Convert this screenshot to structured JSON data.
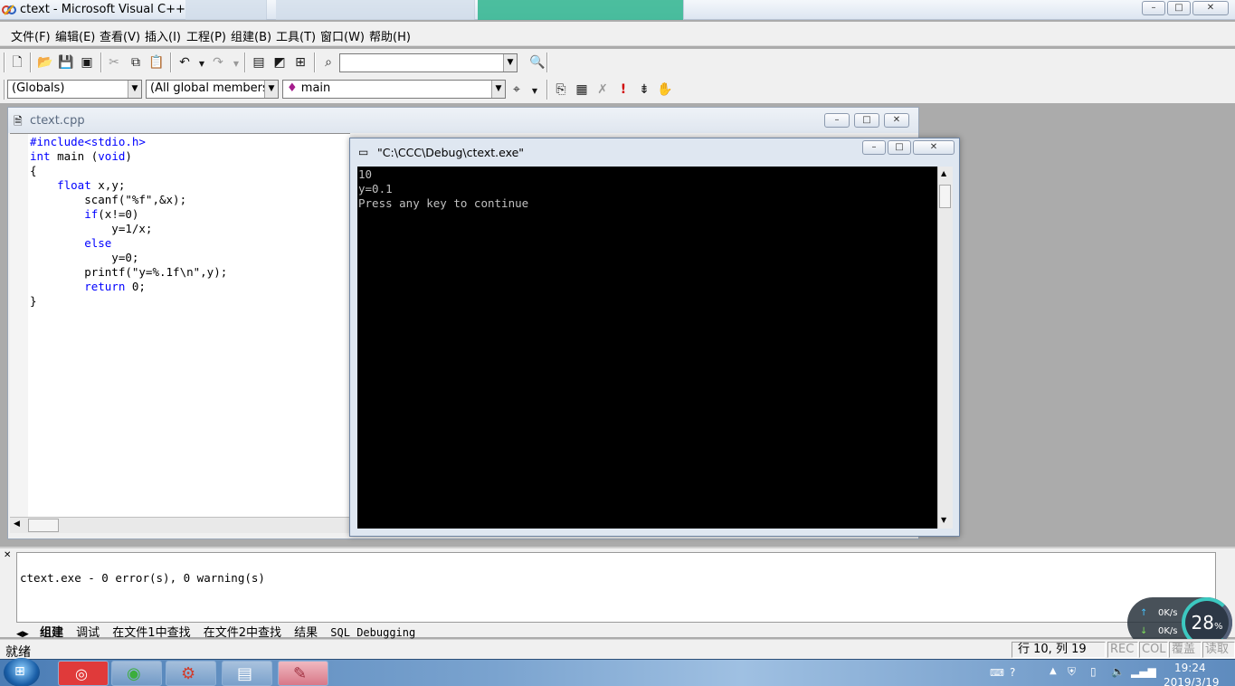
{
  "window": {
    "title": "ctext - Microsoft Visual C++",
    "buttons": {
      "minimize": "–",
      "maximize": "□",
      "close": "✕"
    }
  },
  "menu": {
    "items": [
      "文件(F)",
      "编辑(E)",
      "查看(V)",
      "插入(I)",
      "工程(P)",
      "组建(B)",
      "工具(T)",
      "窗口(W)",
      "帮助(H)"
    ]
  },
  "wizardbar": {
    "class_combo": "(Globals)",
    "filter_combo": "(All global members",
    "member_combo": "main"
  },
  "editor": {
    "filename": "ctext.cpp",
    "code_lines": [
      "#include<stdio.h>",
      "int main (void)",
      "{",
      "    float x,y;",
      "        scanf(\"%f\",&x);",
      "        if(x!=0)",
      "            y=1/x;",
      "        else",
      "            y=0;",
      "        printf(\"y=%.1f\\n\",y);",
      "        return 0;",
      "}"
    ]
  },
  "console": {
    "title": "\"C:\\CCC\\Debug\\ctext.exe\"",
    "lines": [
      "10",
      "y=0.1",
      "Press any key to continue"
    ]
  },
  "output": {
    "message": "ctext.exe - 0 error(s), 0 warning(s)",
    "tabs": [
      "组建",
      "调试",
      "在文件1中查找",
      "在文件2中查找",
      "结果",
      "SQL Debugging"
    ]
  },
  "statusbar": {
    "ready": "就绪",
    "position": "行 10, 列 19",
    "rec": "REC",
    "col": "COL",
    "ovr": "覆盖",
    "read": "读取"
  },
  "network_widget": {
    "up": "0K/s",
    "down": "0K/s",
    "percent": "28",
    "percent_unit": "%"
  },
  "taskbar": {
    "time": "19:24",
    "date": "2019/3/19"
  }
}
